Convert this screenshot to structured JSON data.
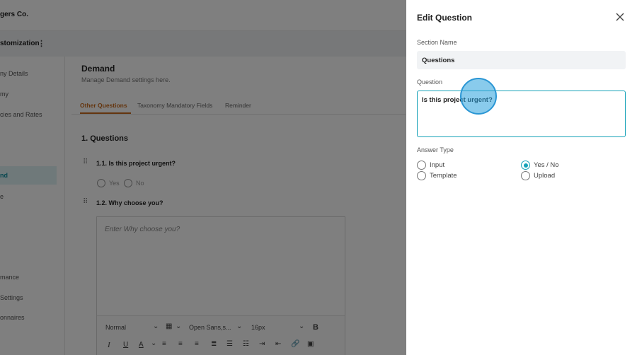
{
  "app": {
    "brand": "gers Co.",
    "subbar_title": "stomization",
    "kebab": "⋮"
  },
  "sidebar": {
    "items": [
      {
        "label": "ny Details"
      },
      {
        "label": "my"
      },
      {
        "label": "cies and Rates"
      },
      {
        "label": "nd"
      },
      {
        "label": "e"
      },
      {
        "label": "mance"
      },
      {
        "label": "Settings"
      },
      {
        "label": "onnaires"
      }
    ]
  },
  "page": {
    "title": "Demand",
    "subtitle": "Manage Demand settings here.",
    "tabs": [
      {
        "label": "Other Questions"
      },
      {
        "label": "Taxonomy Mandatory Fields"
      },
      {
        "label": "Reminder"
      }
    ],
    "section_title": "1. Questions",
    "questions": [
      {
        "label": "1.1. Is this project urgent?"
      },
      {
        "label": "1.2. Why choose you?"
      }
    ],
    "bg_options": {
      "yes": "Yes",
      "no": "No"
    },
    "editor_placeholder": "Enter Why choose you?",
    "toolbar": {
      "format": "Normal",
      "font": "Open Sans,s...",
      "size": "16px",
      "bold": "B",
      "italic": "I",
      "underline": "U",
      "color": "A"
    }
  },
  "drawer": {
    "title": "Edit Question",
    "section_name_label": "Section Name",
    "section_name_value": "Questions",
    "question_label": "Question",
    "question_value": "Is this project urgent?",
    "answer_type_label": "Answer Type",
    "answer_types": [
      {
        "label": "Input",
        "checked": false
      },
      {
        "label": "Yes / No",
        "checked": true
      },
      {
        "label": "Template",
        "checked": false
      },
      {
        "label": "Upload",
        "checked": false
      }
    ],
    "accent_color": "#17a2b8"
  }
}
